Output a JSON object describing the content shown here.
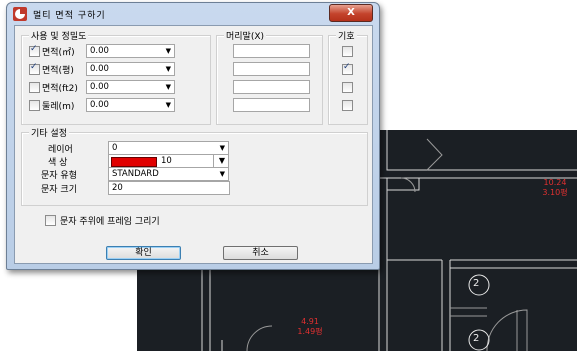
{
  "dialog": {
    "title": "멀티 면적 구하기",
    "close_label": "X"
  },
  "usage_group": {
    "label": "사용 및 정밀도",
    "rows": [
      {
        "label": "면적(㎡)",
        "checked": true,
        "precision": "0.00",
        "prefix_checked": false
      },
      {
        "label": "면적(평)",
        "checked": true,
        "precision": "0.00",
        "prefix_checked": true
      },
      {
        "label": "면적(ft2)",
        "checked": false,
        "precision": "0.00",
        "prefix_checked": false
      },
      {
        "label": "둘레(m)",
        "checked": false,
        "precision": "0.00",
        "prefix_checked": false
      }
    ]
  },
  "prefix_group": {
    "label": "머리말(X)"
  },
  "symbol_group": {
    "label": "기호"
  },
  "other_group": {
    "label": "기타 설정",
    "layer_label": "레이어",
    "layer_value": "0",
    "color_label": "색 상",
    "color_value": "10",
    "color_swatch": "#e00000",
    "text_style_label": "문자 유형",
    "text_style_value": "STANDARD",
    "text_size_label": "문자 크기",
    "text_size_value": "20"
  },
  "frame_option": {
    "label": "문자 주위에 프레임 그리기",
    "checked": false
  },
  "buttons": {
    "ok": "확인",
    "cancel": "취소"
  },
  "canvas": {
    "labels": [
      {
        "line1": "10.24",
        "line2": "3.10평"
      },
      {
        "line1": "4.91",
        "line2": "1.49평"
      }
    ],
    "markers": [
      "2",
      "2"
    ]
  }
}
